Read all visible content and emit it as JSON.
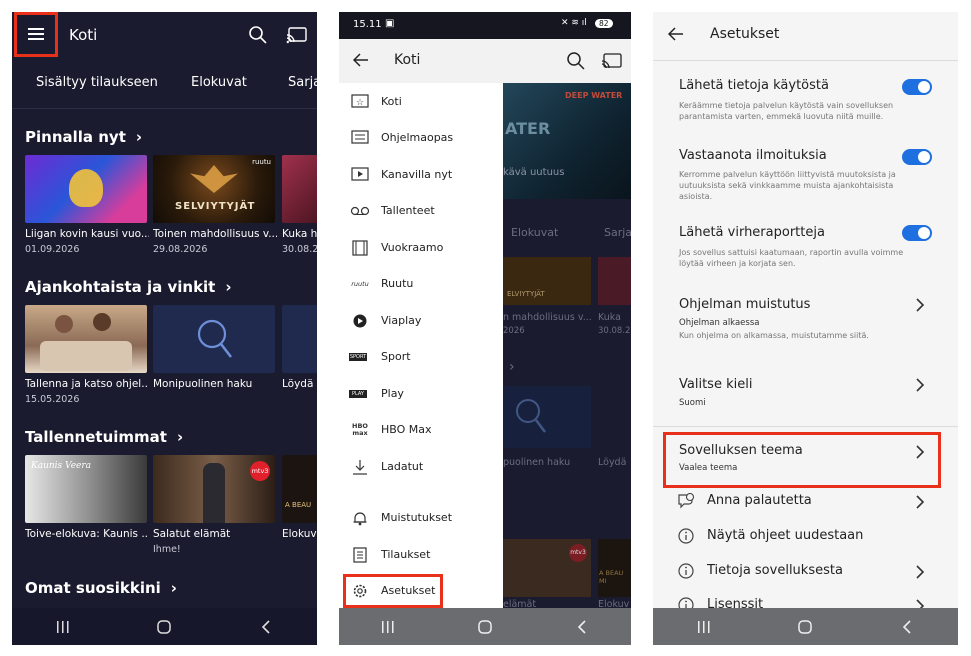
{
  "screen1": {
    "title": "Koti",
    "tabs": [
      "Sisältyy tilaukseen",
      "Elokuvat",
      "Sarja"
    ],
    "sections": [
      {
        "title": "Pinnalla nyt",
        "items": [
          {
            "caption": "Liigan kovin kausi vuo...",
            "sub": "01.09.2026",
            "thumb_text": ""
          },
          {
            "caption": "Toinen mahdollisuus v...",
            "sub": "29.08.2026",
            "thumb_text": "SELVIYTYJÄT"
          },
          {
            "caption": "Kuka h",
            "sub": "30.08.2",
            "thumb_text": ""
          }
        ]
      },
      {
        "title": "Ajankohtaista ja vinkit",
        "items": [
          {
            "caption": "Tallenna ja katso ohjel...",
            "sub": "15.05.2026"
          },
          {
            "caption": "Monipuolinen haku",
            "sub": ""
          },
          {
            "caption": "Löydä",
            "sub": ""
          }
        ]
      },
      {
        "title": "Tallennetuimmat",
        "items": [
          {
            "caption": "Toive-elokuva: Kaunis ...",
            "sub": "",
            "thumb_text": "Kaunis Veera"
          },
          {
            "caption": "Salatut elämät",
            "sub": "Ihme!",
            "thumb_text": ""
          },
          {
            "caption": "Elokuv",
            "sub": "",
            "thumb_text": "A BEAU"
          }
        ]
      },
      {
        "title": "Omat suosikkini",
        "items": []
      }
    ],
    "channel_badge": "mtv3",
    "brand_small": "ruutu"
  },
  "screen2": {
    "status_time": "15.11",
    "battery": "82",
    "title": "Koti",
    "drawer_items": [
      {
        "label": "Koti",
        "icon": "star-tv-icon"
      },
      {
        "label": "Ohjelmaopas",
        "icon": "guide-icon"
      },
      {
        "label": "Kanavilla nyt",
        "icon": "play-screen-icon"
      },
      {
        "label": "Tallenteet",
        "icon": "recording-icon"
      },
      {
        "label": "Vuokraamo",
        "icon": "film-icon"
      },
      {
        "label": "Ruutu",
        "icon": "ruutu-logo-icon"
      },
      {
        "label": "Viaplay",
        "icon": "viaplay-logo-icon"
      },
      {
        "label": "Sport",
        "icon": "sport-logo-icon"
      },
      {
        "label": "Play",
        "icon": "play-logo-icon"
      },
      {
        "label": "HBO Max",
        "icon": "hbo-max-logo-icon"
      },
      {
        "label": "Ladatut",
        "icon": "download-icon"
      },
      {
        "label": "Muistutukset",
        "icon": "bell-icon"
      },
      {
        "label": "Tilaukset",
        "icon": "document-icon"
      },
      {
        "label": "Asetukset",
        "icon": "gear-icon"
      }
    ],
    "bg_text": {
      "deep_water": "DEEP WATER",
      "ater": "ATER",
      "uutuus": "kävä uutuus",
      "elokuvat": "Elokuvat",
      "sarja": "Sarja",
      "selviytyjat": "ELVIYTYJÄT",
      "cap1": "n mahdollisuus v...",
      "cap1b": "Kuka",
      "date1": "2026",
      "date1b": "30.08.2",
      "haku": "puolinen haku",
      "loyda": "Löydä",
      "elamat": "elämät",
      "elokuv": "Elokuv",
      "beau": "A BEAU MI",
      "badge": "mtv3"
    },
    "logos": {
      "ruutu": "ruutu",
      "sport": "SPORT",
      "play": "PLAY",
      "hbo": "HBO",
      "max": "max"
    }
  },
  "screen3": {
    "title": "Asetukset",
    "rows": [
      {
        "title": "Lähetä tietoja käytöstä",
        "desc": "Keräämme tietoja palvelun käytöstä vain sovelluksen parantamista varten, emmekä luovuta niitä muille.",
        "control": "toggle",
        "on": true
      },
      {
        "title": "Vastaanota ilmoituksia",
        "desc": "Kerromme palvelun käyttöön liittyvistä muutoksista ja uutuuksista sekä vinkkaamme muista ajankohtaisista asioista.",
        "control": "toggle",
        "on": true
      },
      {
        "title": "Lähetä virheraportteja",
        "desc": "Jos sovellus sattuisi kaatumaan, raportin avulla voimme löytää virheen ja korjata sen.",
        "control": "toggle",
        "on": true
      },
      {
        "title": "Ohjelman muistutus",
        "value": "Ohjelman alkaessa",
        "desc": "Kun ohjelma on alkamassa, muistutamme siitä.",
        "control": "chevron"
      },
      {
        "title": "Valitse kieli",
        "value": "Suomi",
        "control": "chevron"
      },
      {
        "title": "Sovelluksen teema",
        "value": "Vaalea teema",
        "control": "chevron"
      },
      {
        "title": "Anna palautetta",
        "control": "chevron",
        "icon": "chat-icon"
      },
      {
        "title": "Näytä ohjeet uudestaan",
        "icon": "info-icon"
      },
      {
        "title": "Tietoja sovelluksesta",
        "control": "chevron",
        "icon": "info-icon"
      },
      {
        "title": "Lisenssit",
        "control": "chevron",
        "icon": "info-icon"
      }
    ]
  },
  "colors": {
    "highlight": "#e8301b",
    "toggle": "#1e6fe0",
    "dark_bg": "#1a1b2e"
  }
}
